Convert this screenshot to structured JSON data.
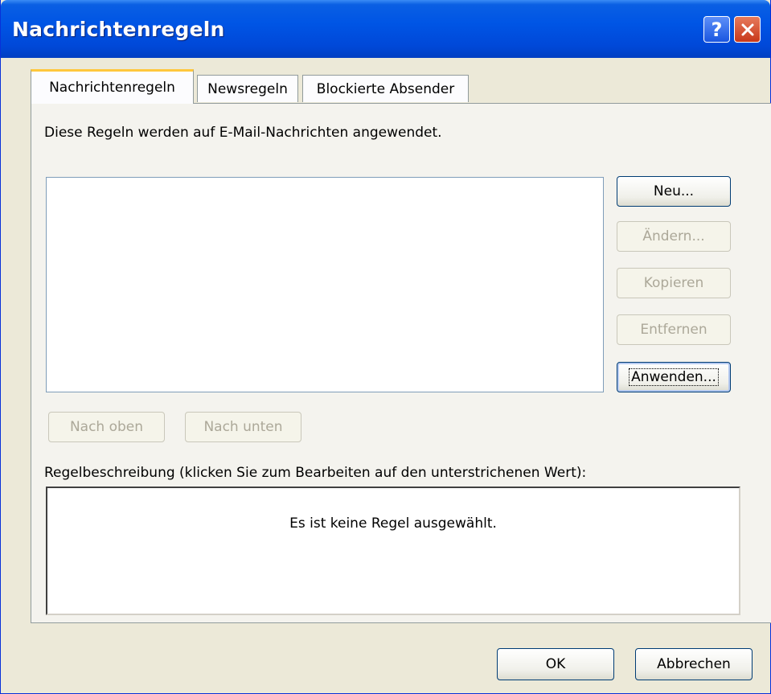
{
  "window": {
    "title": "Nachrichtenregeln"
  },
  "titlebar": {
    "help_label": "?"
  },
  "tabs": [
    {
      "label": "Nachrichtenregeln",
      "active": true
    },
    {
      "label": "Newsregeln",
      "active": false
    },
    {
      "label": "Blockierte Absender",
      "active": false
    }
  ],
  "panel": {
    "description": "Diese Regeln werden auf E-Mail-Nachrichten angewendet.",
    "buttons": {
      "new": "Neu...",
      "change": "Ändern...",
      "copy": "Kopieren",
      "remove": "Entfernen",
      "apply": "Anwenden...",
      "move_up": "Nach oben",
      "move_down": "Nach unten"
    },
    "rule_description_label": "Regelbeschreibung (klicken Sie zum Bearbeiten auf den unterstrichenen Wert):",
    "rule_description_text": "Es ist keine Regel ausgewählt."
  },
  "footer": {
    "ok": "OK",
    "cancel": "Abbrechen"
  },
  "colors": {
    "titlebar": "#0055e5",
    "dialog_bg": "#ece9d8",
    "active_tab_accent": "#ffc73c"
  },
  "icons": [
    "help-icon",
    "close-icon"
  ]
}
